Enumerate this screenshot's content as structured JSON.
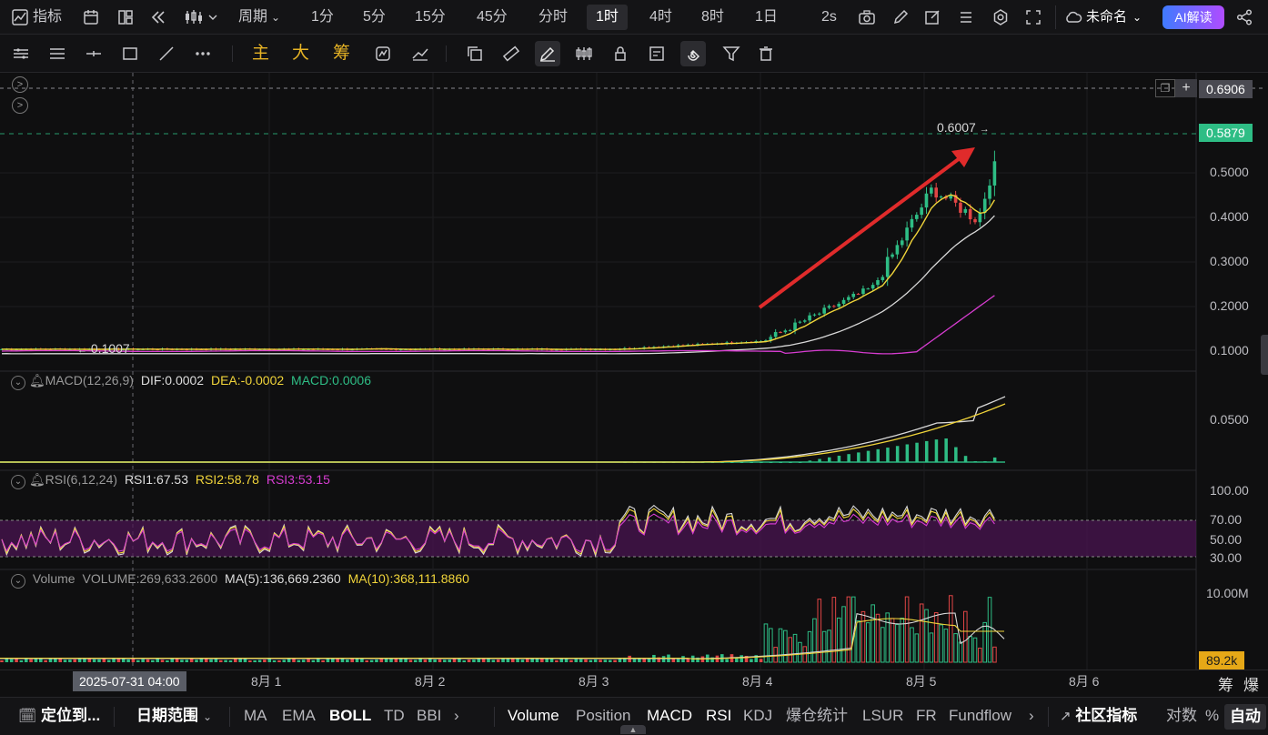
{
  "toolbar": {
    "indicators_label": "指标",
    "period_label": "周期",
    "intervals": [
      "1分",
      "5分",
      "15分",
      "45分",
      "分时",
      "1时",
      "4时",
      "8时",
      "1日"
    ],
    "active_interval": "1时",
    "refresh_label": "2s",
    "layout_name": "未命名",
    "ai_label": "AI解读"
  },
  "drawbar": {
    "main_label": "主",
    "big_label": "大",
    "chip_label": "筹"
  },
  "main_pane": {
    "y_ticks": [
      "0.5000",
      "0.4000",
      "0.3000",
      "0.2000",
      "0.1000"
    ],
    "crosshair_price": "0.6906",
    "last_price": "0.5879",
    "high_label": "0.6007",
    "low_label": "0.1007",
    "colors": {
      "up": "#2ebd85",
      "down": "#e04545",
      "ma_yellow": "#f0d43a",
      "ma_white": "#d8d8d8",
      "ma_magenta": "#d63cd0",
      "arrow": "#e02b2b"
    }
  },
  "macd": {
    "name": "MACD(12,26,9)",
    "dif": "DIF:0.0002",
    "dea": "DEA:-0.0002",
    "macd": "MACD:0.0006",
    "y_tick": "0.0500"
  },
  "rsi": {
    "name": "RSI(6,12,24)",
    "rsi1": "RSI1:67.53",
    "rsi2": "RSI2:58.78",
    "rsi3": "RSI3:53.15",
    "y_ticks": [
      "100.00",
      "70.00",
      "50.00",
      "30.00"
    ]
  },
  "volume": {
    "name": "Volume",
    "value": "VOLUME:269,633.2600",
    "ma5": "MA(5):136,669.2360",
    "ma10": "MA(10):368,111.8860",
    "y_tick": "10.00M",
    "last_tag": "89.2k"
  },
  "x_axis": {
    "crosshair_time": "2025-07-31 04:00",
    "ticks": [
      "8月 1",
      "8月 2",
      "8月 3",
      "8月 4",
      "8月 5",
      "8月 6"
    ],
    "corner_a": "筹",
    "corner_b": "爆"
  },
  "bottombar": {
    "locate": "定位到...",
    "date_range": "日期范围",
    "main_inds": [
      "MA",
      "EMA",
      "BOLL",
      "TD",
      "BBI"
    ],
    "sub_inds": [
      "Volume",
      "Position",
      "MACD",
      "RSI",
      "KDJ",
      "爆仓统计",
      "LSUR",
      "FR",
      "Fundflow"
    ],
    "community": "社区指标",
    "log": "对数",
    "pct": "%",
    "auto": "自动"
  }
}
